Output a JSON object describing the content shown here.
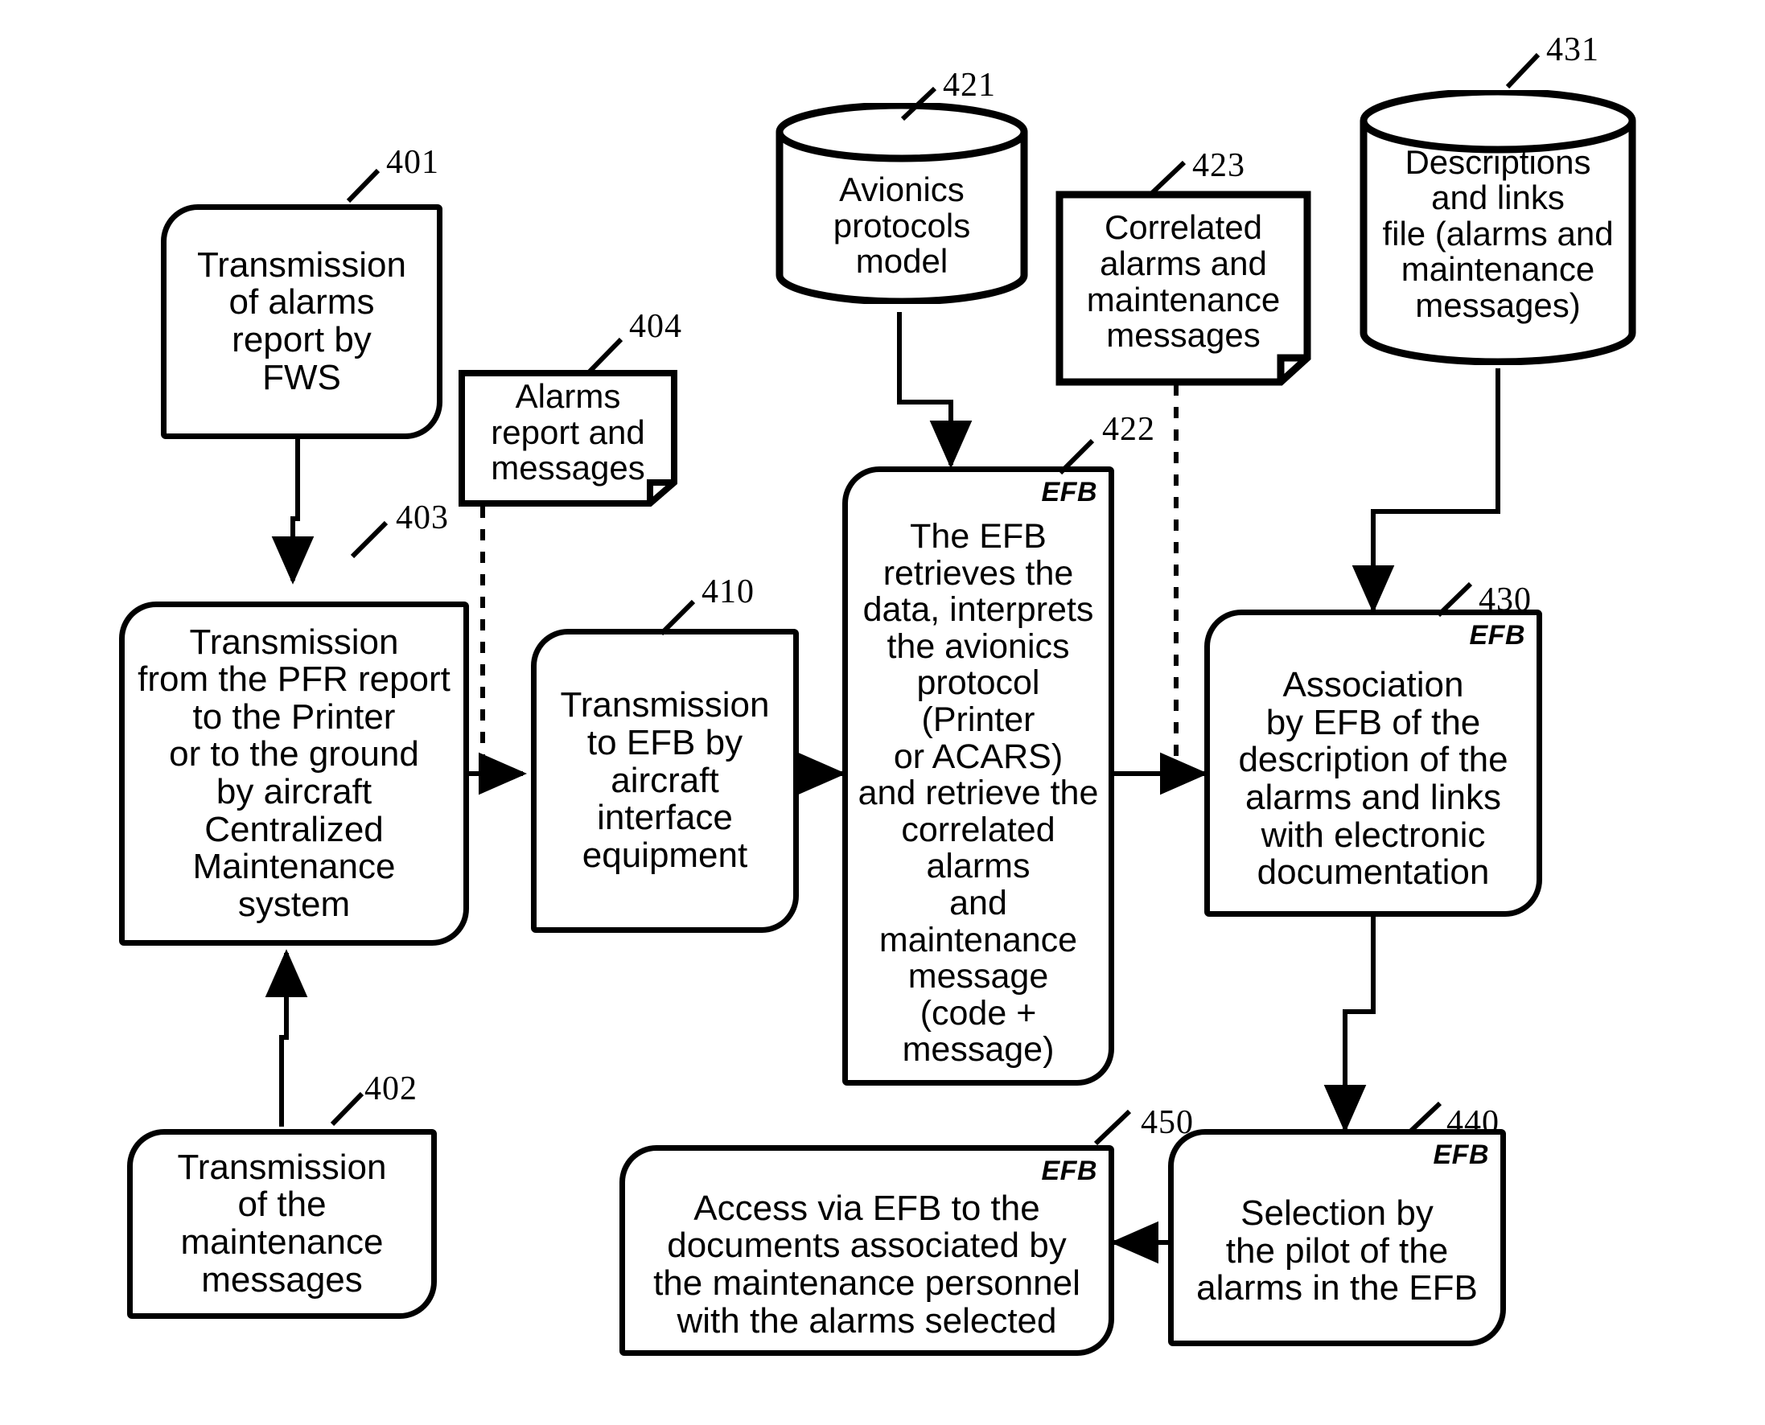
{
  "figure": {
    "style": {
      "stroke": "#000000",
      "fill": "#ffffff",
      "background": "#ffffff"
    }
  },
  "nodes": {
    "n401": {
      "ref": "401",
      "text": "Transmission\nof alarms\nreport by\nFWS",
      "shape": "rounded-process"
    },
    "n402": {
      "ref": "402",
      "text": "Transmission\nof the\nmaintenance\nmessages",
      "shape": "rounded-process"
    },
    "n403": {
      "ref": "403",
      "text": "Transmission\nfrom the PFR report\nto the Printer\nor to the ground\nby aircraft\nCentralized\nMaintenance\nsystem",
      "shape": "rounded-process"
    },
    "n404": {
      "ref": "404",
      "text": "Alarms\nreport and\nmessages",
      "shape": "note"
    },
    "n410": {
      "ref": "410",
      "text": "Transmission\nto EFB by\naircraft\ninterface\nequipment",
      "shape": "rounded-process"
    },
    "n421": {
      "ref": "421",
      "text": "Avionics\nprotocols\nmodel",
      "shape": "cylinder"
    },
    "n422": {
      "ref": "422",
      "tag": "EFB",
      "text": "The EFB\nretrieves the\ndata, interprets\nthe avionics\nprotocol\n(Printer\nor ACARS)\nand retrieve the\ncorrelated\nalarms\nand\nmaintenance\nmessage\n(code +\nmessage)",
      "shape": "rounded-process"
    },
    "n423": {
      "ref": "423",
      "text": "Correlated\nalarms and\nmaintenance\nmessages",
      "shape": "note"
    },
    "n430": {
      "ref": "430",
      "tag": "EFB",
      "text": "Association\nby EFB of the\ndescription of the\nalarms and links\nwith electronic\ndocumentation",
      "shape": "rounded-process"
    },
    "n431": {
      "ref": "431",
      "text": "Descriptions\nand links\nfile (alarms and\nmaintenance\nmessages)",
      "shape": "cylinder"
    },
    "n440": {
      "ref": "440",
      "tag": "EFB",
      "text": "Selection by\nthe pilot of the\nalarms in the EFB",
      "shape": "rounded-process"
    },
    "n450": {
      "ref": "450",
      "tag": "EFB",
      "text": "Access via EFB to the\ndocuments associated by\nthe maintenance personnel\nwith the alarms selected",
      "shape": "rounded-process"
    }
  },
  "edges": [
    {
      "id": "e401-403",
      "from": "n401",
      "to": "n403",
      "style": "solid",
      "arrow": true
    },
    {
      "id": "e402-403",
      "from": "n402",
      "to": "n403",
      "style": "solid",
      "arrow": true
    },
    {
      "id": "e404-410",
      "from": "n404",
      "to": "n410",
      "style": "dashed",
      "arrow": true
    },
    {
      "id": "e403-410",
      "from": "n403",
      "to": "n410",
      "style": "solid",
      "arrow": true
    },
    {
      "id": "e410-422",
      "from": "n410",
      "to": "n422",
      "style": "solid",
      "arrow": true
    },
    {
      "id": "e421-422",
      "from": "n421",
      "to": "n422",
      "style": "solid",
      "arrow": true
    },
    {
      "id": "e423-430",
      "from": "n423",
      "to": "n430",
      "style": "dashed",
      "arrow": true
    },
    {
      "id": "e422-430",
      "from": "n422",
      "to": "n430",
      "style": "solid",
      "arrow": true
    },
    {
      "id": "e431-430",
      "from": "n431",
      "to": "n430",
      "style": "solid",
      "arrow": true
    },
    {
      "id": "e430-440",
      "from": "n430",
      "to": "n440",
      "style": "solid",
      "arrow": true
    },
    {
      "id": "e440-450",
      "from": "n440",
      "to": "n450",
      "style": "solid",
      "arrow": true
    }
  ]
}
